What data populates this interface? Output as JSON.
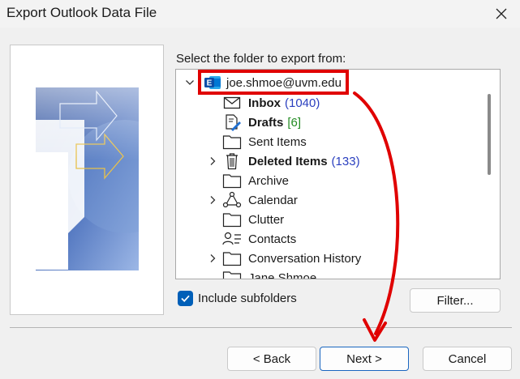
{
  "window": {
    "title": "Export Outlook Data File"
  },
  "dialog": {
    "folder_prompt": "Select the folder to export from:",
    "tree": [
      {
        "label": "joe.shmoe@uvm.edu",
        "icon": "exchange-account-icon",
        "bold": false,
        "count": ""
      },
      {
        "label": "Inbox",
        "icon": "mail-envelope-icon",
        "bold": true,
        "count": "(1040)",
        "count_color": "#2a3fbf"
      },
      {
        "label": "Drafts",
        "icon": "draft-pencil-icon",
        "bold": true,
        "count": "[6]",
        "count_color": "#228b22"
      },
      {
        "label": "Sent Items",
        "icon": "folder-icon",
        "bold": false,
        "count": ""
      },
      {
        "label": "Deleted Items",
        "icon": "trash-icon",
        "bold": true,
        "count": "(133)",
        "count_color": "#2a3fbf"
      },
      {
        "label": "Archive",
        "icon": "folder-icon",
        "bold": false,
        "count": ""
      },
      {
        "label": "Calendar",
        "icon": "calendar-icon",
        "bold": false,
        "count": ""
      },
      {
        "label": "Clutter",
        "icon": "folder-icon",
        "bold": false,
        "count": ""
      },
      {
        "label": "Contacts",
        "icon": "contacts-icon",
        "bold": false,
        "count": ""
      },
      {
        "label": "Conversation History",
        "icon": "folder-icon",
        "bold": false,
        "count": ""
      },
      {
        "label": "Jane Shmoe",
        "icon": "folder-icon",
        "bold": false,
        "count": ""
      }
    ],
    "include_subfolders_label": "Include subfolders",
    "include_subfolders_checked": true,
    "filter_label": "Filter...",
    "back_label": "< Back",
    "next_label": "Next >",
    "cancel_label": "Cancel"
  },
  "colors": {
    "annotation_red": "#e00000",
    "checkbox_blue": "#005fb8",
    "primary_border": "#1a66c0"
  }
}
